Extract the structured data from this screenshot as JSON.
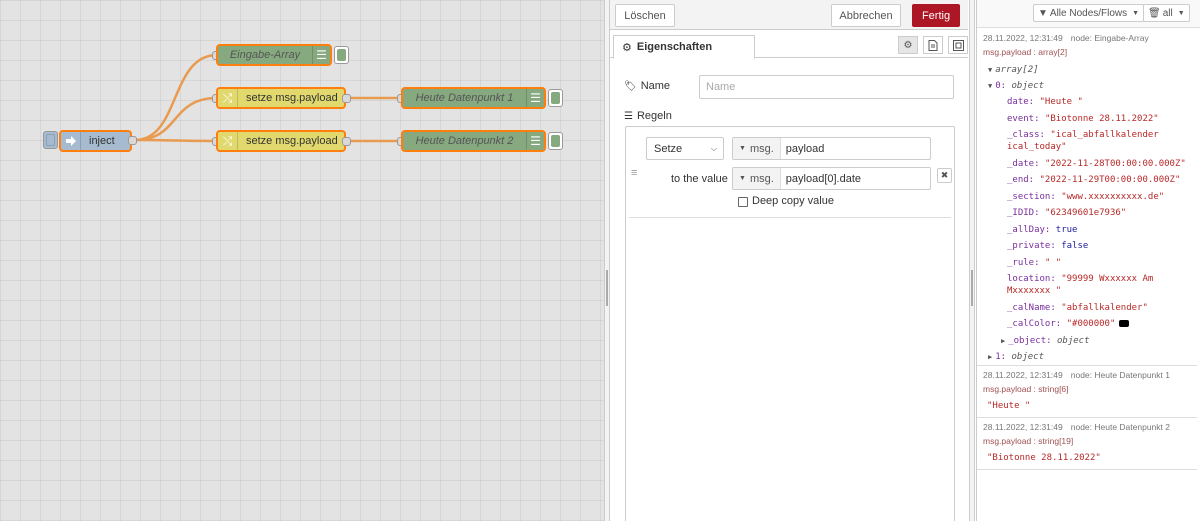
{
  "flow": {
    "nodes": {
      "inject": "inject",
      "eingabe": "Eingabe-Array",
      "change1": "setze msg.payload",
      "change2": "setze msg.payload",
      "debug1": "Heute Datenpunkt 1",
      "debug2": "Heute Datenpunkt 2"
    },
    "colors": {
      "wire": "#e89b50",
      "selected": "#ff7f0e",
      "change": "#e2d96e",
      "debug": "#87a980",
      "inject": "#a6bbcf"
    }
  },
  "tray": {
    "delete_label": "Löschen",
    "cancel_label": "Abbrechen",
    "done_label": "Fertig",
    "tab_label": "Eigenschaften",
    "name_label": "Name",
    "name_placeholder": "Name",
    "rules_label": "Regeln",
    "rule": {
      "action": "Setze",
      "target_type": "msg.",
      "target_value": "payload",
      "to_label": "to the value",
      "source_type": "msg.",
      "source_value": "payload[0].date",
      "deep_copy_label": "Deep copy value"
    },
    "colors": {
      "primary": "#ad1625"
    }
  },
  "sidebar": {
    "filter_label": "Alle Nodes/Flows",
    "clear_label": "all",
    "messages": [
      {
        "timestamp": "28.11.2022, 12:31:49",
        "node": "node: Eingabe-Array",
        "topic": "msg.payload : array[2]"
      },
      {
        "timestamp": "28.11.2022, 12:31:49",
        "node": "node: Heute Datenpunkt 1",
        "topic": "msg.payload : string[6]",
        "value": "\"Heute \""
      },
      {
        "timestamp": "28.11.2022, 12:31:49",
        "node": "node: Heute Datenpunkt 2",
        "topic": "msg.payload : string[19]",
        "value": "\"Biotonne 28.11.2022\""
      }
    ],
    "tree": {
      "root": "array[2]",
      "item0_key": "0:",
      "item0_type": "object",
      "props": [
        {
          "key": "date:",
          "value": "\"Heute \"",
          "kind": "str"
        },
        {
          "key": "event:",
          "value": "\"Biotonne 28.11.2022\"",
          "kind": "str"
        },
        {
          "key": "_class:",
          "value": "\"ical_abfallkalender",
          "kind": "str",
          "value2": "ical_today\""
        },
        {
          "key": "_date:",
          "value": "\"2022-11-28T00:00:00.000Z\"",
          "kind": "str"
        },
        {
          "key": "_end:",
          "value": "\"2022-11-29T00:00:00.000Z\"",
          "kind": "str"
        },
        {
          "key": "_section:",
          "value": "\"www.xxxxxxxxxx.de\"",
          "kind": "str"
        },
        {
          "key": "_IDID:",
          "value": "\"62349601e7936\"",
          "kind": "str"
        },
        {
          "key": "_allDay:",
          "value": "true",
          "kind": "bool"
        },
        {
          "key": "_private:",
          "value": "false",
          "kind": "bool"
        },
        {
          "key": "_rule:",
          "value": "\" \"",
          "kind": "str"
        },
        {
          "key": "location:",
          "value": "\"99999 Wxxxxxx Am",
          "kind": "str",
          "value2": "Mxxxxxxx \""
        },
        {
          "key": "_calName:",
          "value": "\"abfallkalender\"",
          "kind": "str"
        },
        {
          "key": "_calColor:",
          "value": "\"#000000\"",
          "kind": "str"
        }
      ],
      "object_key": "_object:",
      "object_type": "object",
      "item1_key": "1:",
      "item1_type": "object"
    }
  }
}
